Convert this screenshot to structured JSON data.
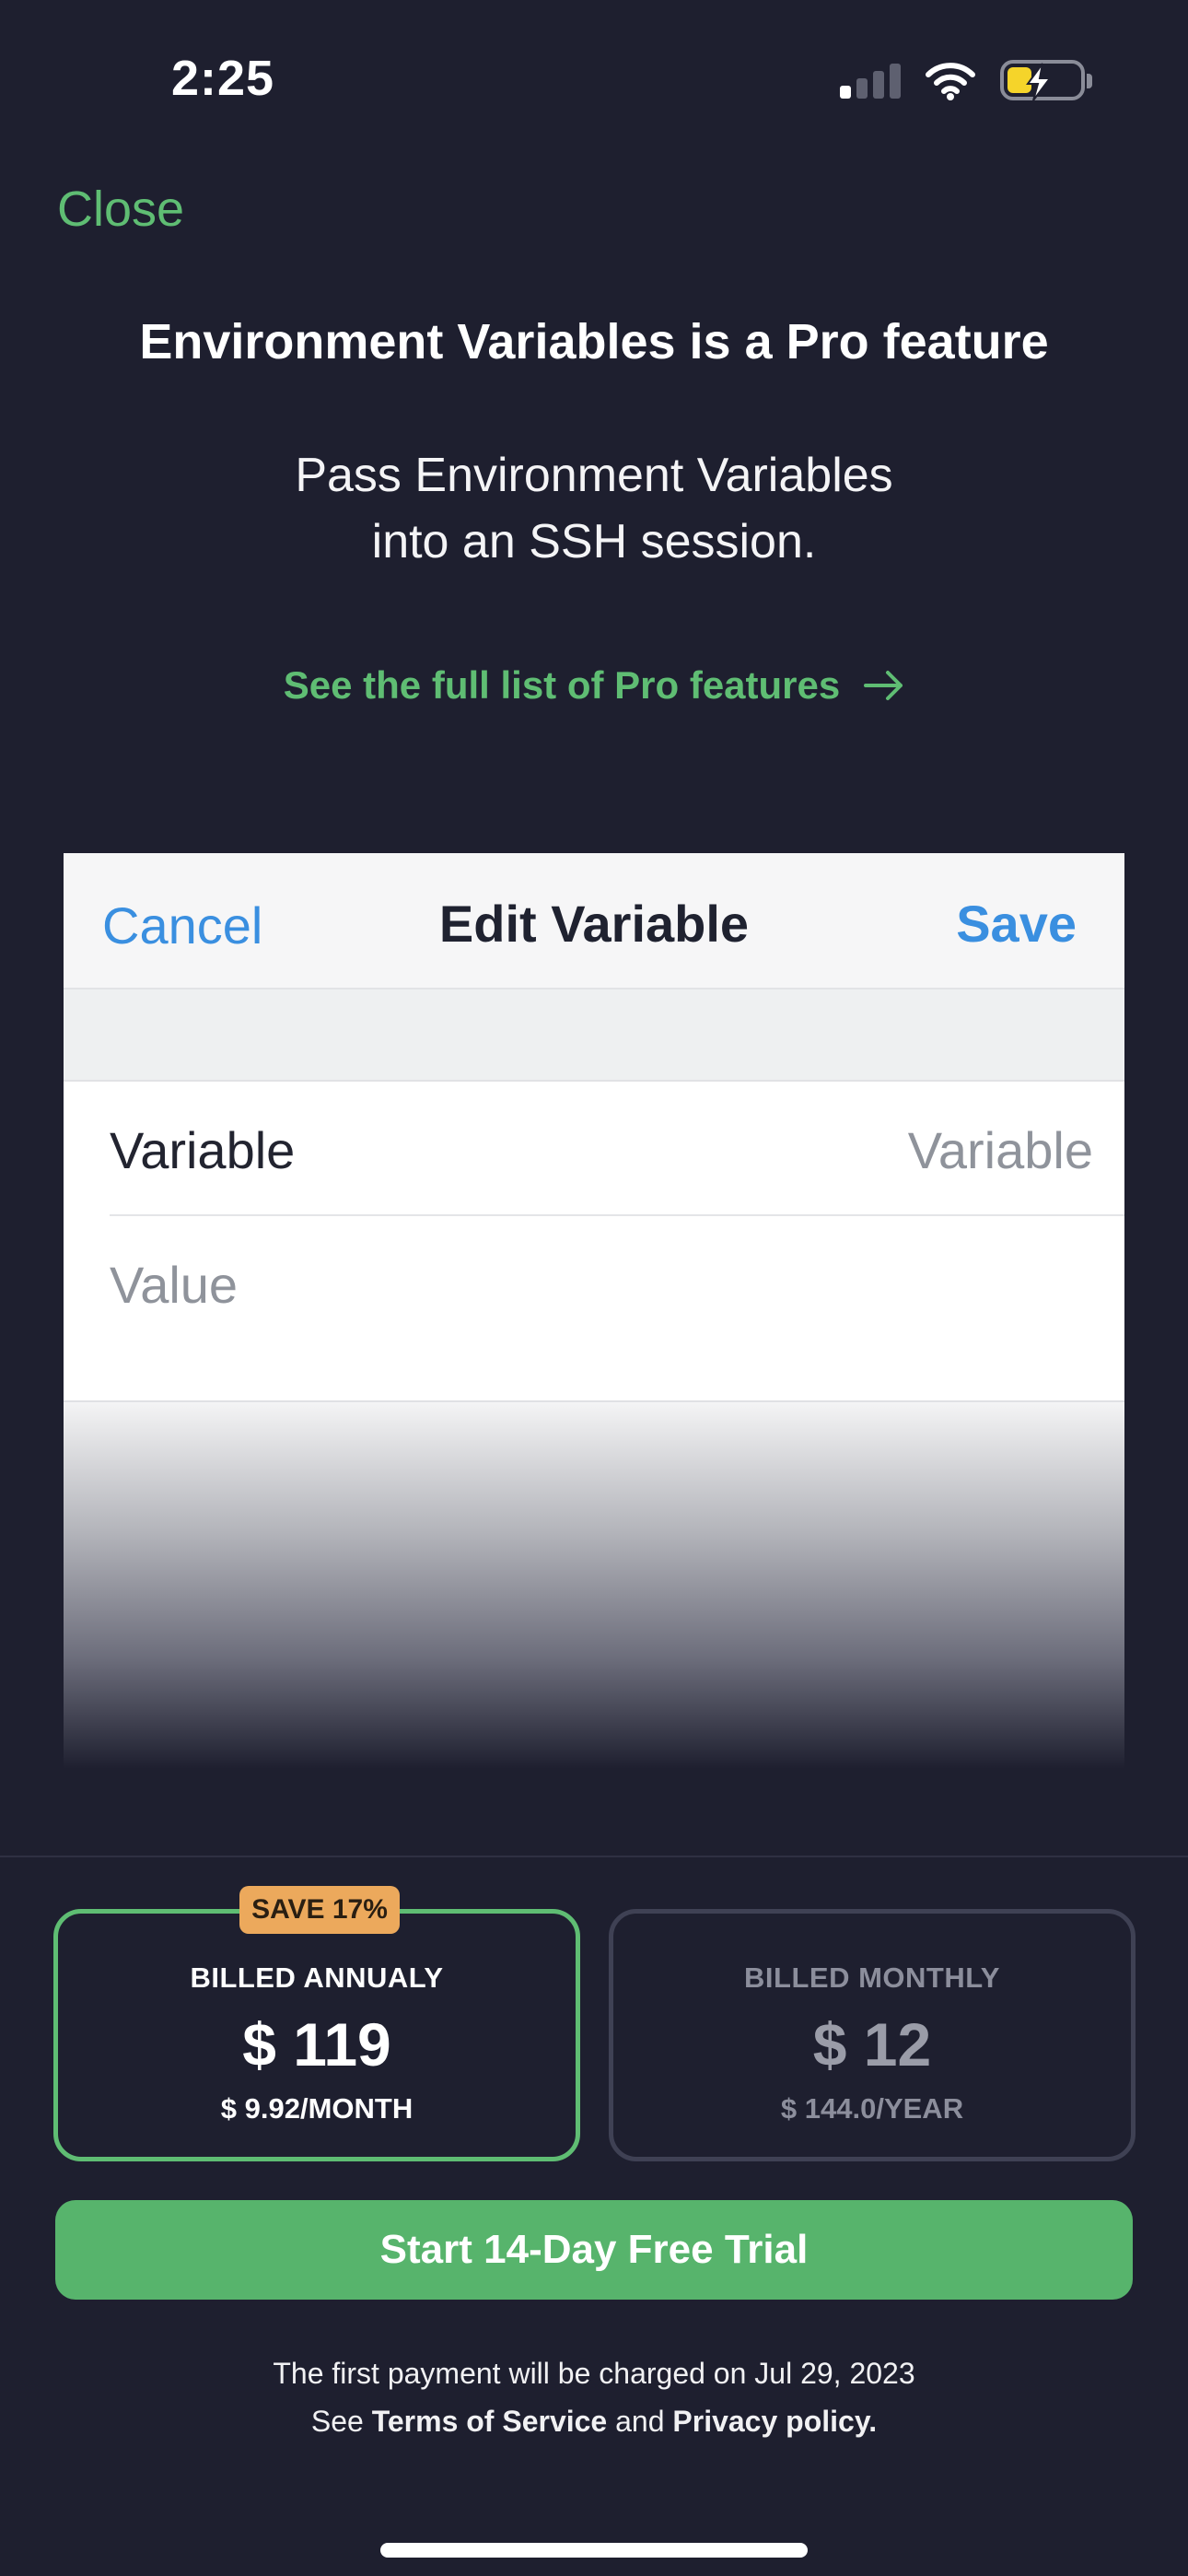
{
  "status_bar": {
    "time": "2:25",
    "icons": [
      "cellular-signal-icon",
      "wifi-icon",
      "battery-charging-icon"
    ]
  },
  "header": {
    "close_label": "Close"
  },
  "headline": "Environment Variables is a Pro feature",
  "subtitle_lines": [
    "Pass Environment Variables",
    "into an SSH session."
  ],
  "see_all_link": {
    "label": "See the full list of Pro features",
    "icon": "arrow-right-icon"
  },
  "preview": {
    "cancel_label": "Cancel",
    "title": "Edit Variable",
    "save_label": "Save",
    "variable_label": "Variable",
    "variable_placeholder": "Variable",
    "value_placeholder": "Value"
  },
  "plans": {
    "annual": {
      "badge": "SAVE 17%",
      "label": "BILLED ANNUALY",
      "price": "$ 119",
      "sub": "$ 9.92/MONTH",
      "selected": true
    },
    "monthly": {
      "label": "BILLED MONTHLY",
      "price": "$ 12",
      "sub": "$ 144.0/YEAR",
      "selected": false
    }
  },
  "cta_label": "Start 14-Day Free Trial",
  "footer": {
    "line1": "The first payment will be charged on Jul 29, 2023",
    "line2_prefix": "See",
    "terms_label": "Terms of Service",
    "and": "and",
    "privacy_label": "Privacy policy."
  },
  "colors": {
    "background": "#1e1f2f",
    "accent_green": "#5fbd73",
    "ios_blue": "#3a8fe0",
    "badge_orange": "#eca95c"
  }
}
